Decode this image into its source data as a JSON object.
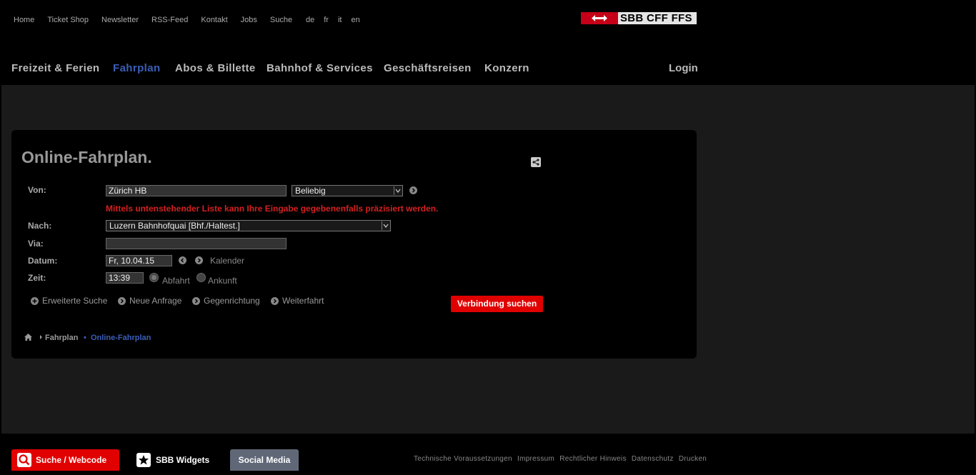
{
  "utility_nav": [
    "Home",
    "Ticket Shop",
    "Newsletter",
    "RSS-Feed",
    "Kontakt",
    "Jobs",
    "Suche"
  ],
  "languages": [
    "de",
    "fr",
    "it",
    "en"
  ],
  "logo": {
    "text": "SBB CFF FFS",
    "color": "#c60018"
  },
  "main_nav": {
    "items": [
      "Freizeit & Ferien",
      "Fahrplan",
      "Abos & Billette",
      "Bahnhof & Services",
      "Geschäftsreisen",
      "Konzern"
    ],
    "active": "Fahrplan",
    "login": "Login"
  },
  "form": {
    "title": "Online-Fahrplan.",
    "from_label": "Von:",
    "from_value": "Zürich HB",
    "from_type": "Beliebig",
    "warning": "Mittels untenstehender Liste kann Ihre Eingabe gegebenenfalls präzisiert werden.",
    "to_label": "Nach:",
    "to_value": "Luzern Bahnhofquai [Bhf./Haltest.]",
    "via_label": "Via:",
    "via_value": "",
    "date_label": "Datum:",
    "date_value": "Fr, 10.04.15",
    "calendar": "Kalender",
    "time_label": "Zeit:",
    "time_value": "13:39",
    "departure": "Abfahrt",
    "arrival": "Ankunft",
    "links": [
      "Erweiterte Suche",
      "Neue Anfrage",
      "Gegenrichtung",
      "Weiterfahrt"
    ],
    "submit": "Verbindung suchen"
  },
  "breadcrumb": {
    "parent": "Fahrplan",
    "current": "Online-Fahrplan"
  },
  "footer": {
    "search": "Suche / Webcode",
    "widgets": "SBB Widgets",
    "social": "Social Media",
    "links": [
      "Technische Voraussetzungen",
      "Impressum",
      "Rechtlicher Hinweis",
      "Datenschutz",
      "Drucken"
    ]
  }
}
